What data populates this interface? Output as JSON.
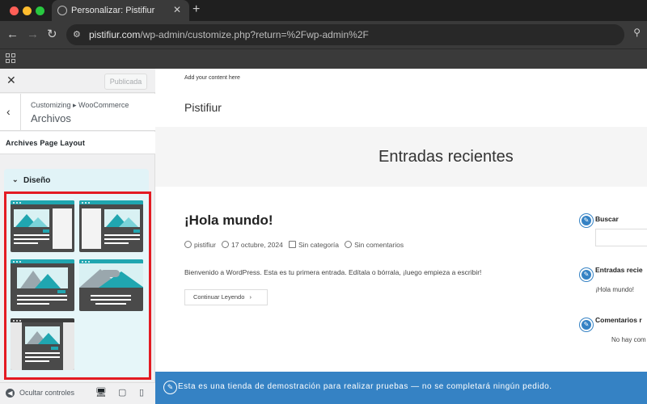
{
  "browser": {
    "tab_title": "Personalizar: Pistifiur",
    "new_tab": "+",
    "tab_close": "✕",
    "url_host": "pistifiur.com",
    "url_path": "/wp-admin/customize.php?return=%2Fwp-admin%2F",
    "colors": {
      "red": "#ff5f57",
      "yellow": "#febc2e",
      "green": "#28c840"
    }
  },
  "customizer": {
    "close": "✕",
    "publish_label": "Publicada",
    "breadcrumb": "Customizing ▸ WooCommerce",
    "section_title": "Archivos",
    "layout_title": "Archives Page Layout",
    "design_label": "Diseño",
    "layout_options": [
      "layout-image-left-sidebar-right",
      "layout-sidebar-left-image-right",
      "layout-full-image-top",
      "layout-full-wide-image",
      "layout-boxed-image-center"
    ],
    "footer": {
      "hide_label": "Ocultar controles",
      "devices": [
        "desktop-icon",
        "tablet-icon",
        "mobile-icon"
      ]
    },
    "highlight_color": "#e31b23"
  },
  "preview": {
    "top_note": "Add your content here",
    "site_title": "Pistifiur",
    "hero_title": "Entradas recientes",
    "post_title": "¡Hola mundo!",
    "meta": {
      "author": "pistifiur",
      "date": "17 octubre, 2024",
      "category": "Sin categoría",
      "comments": "Sin comentarios"
    },
    "excerpt": "Bienvenido a WordPress. Esta es tu primera entrada. Edítala o bórrala, ¡luego empieza a escribir!",
    "read_more": "Continuar Leyendo",
    "read_more_arrow": "›",
    "widgets": {
      "search": "Buscar",
      "recent_posts": "Entradas recie",
      "recent_post_item": "¡Hola mundo!",
      "recent_comments": "Comentarios r",
      "no_comments": "No hay com"
    },
    "notice": "Esta es una tienda de demostración para realizar pruebas — no se completará ningún pedido.",
    "accent": "#3582c4"
  }
}
